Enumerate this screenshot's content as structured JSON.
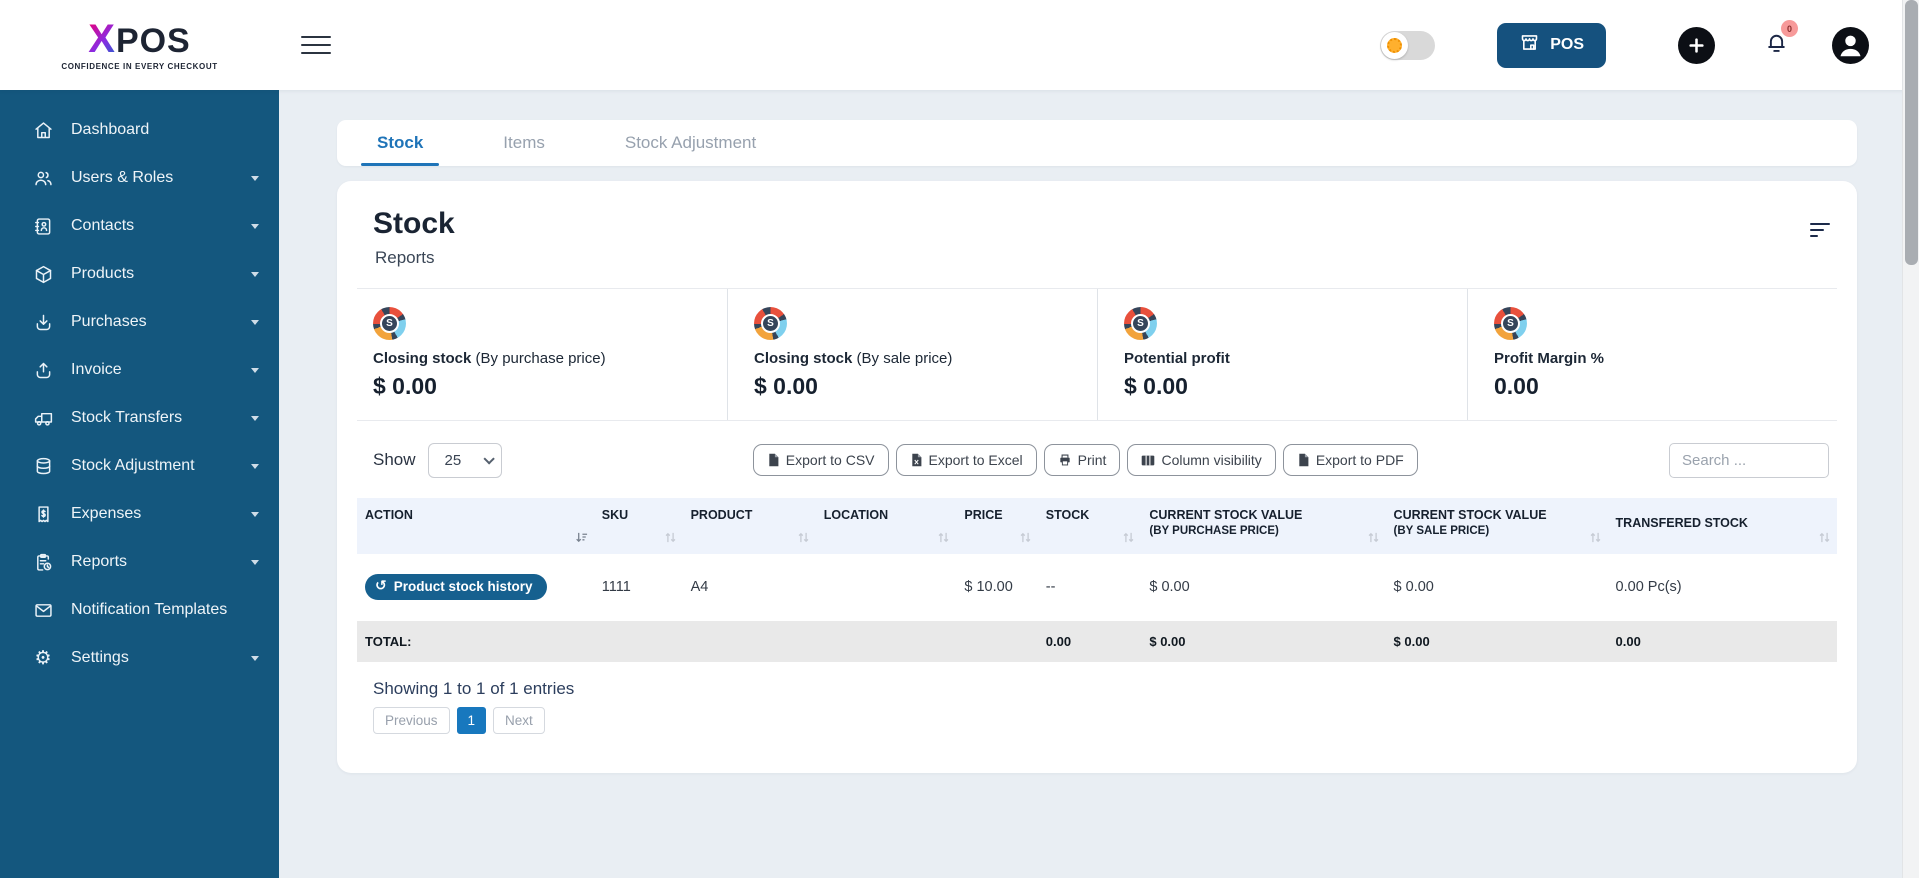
{
  "brand": {
    "name_x": "X",
    "name_rest": "POS",
    "tagline": "CONFIDENCE IN EVERY CHECKOUT"
  },
  "topbar": {
    "pos_label": "POS",
    "bell_badge": "0"
  },
  "sidebar": {
    "items": [
      {
        "label": "Dashboard",
        "icon": "home-icon"
      },
      {
        "label": "Users & Roles",
        "icon": "users-icon"
      },
      {
        "label": "Contacts",
        "icon": "address-book-icon"
      },
      {
        "label": "Products",
        "icon": "box-icon"
      },
      {
        "label": "Purchases",
        "icon": "arrow-down-tray-icon"
      },
      {
        "label": "Invoice",
        "icon": "arrow-up-tray-icon"
      },
      {
        "label": "Stock Transfers",
        "icon": "truck-icon"
      },
      {
        "label": "Stock Adjustment",
        "icon": "database-icon"
      },
      {
        "label": "Expenses",
        "icon": "receipt-icon"
      },
      {
        "label": "Reports",
        "icon": "clipboard-clock-icon"
      },
      {
        "label": "Notification Templates",
        "icon": "envelope-icon"
      },
      {
        "label": "Settings",
        "icon": "gear-icon"
      }
    ]
  },
  "tabs": [
    {
      "label": "Stock",
      "active": true
    },
    {
      "label": "Items",
      "active": false
    },
    {
      "label": "Stock Adjustment",
      "active": false
    }
  ],
  "page": {
    "title": "Stock",
    "subtitle": "Reports"
  },
  "stats": [
    {
      "label": "Closing stock",
      "sublabel": "(By purchase price)",
      "value": "$ 0.00",
      "icon": "stock-donut-icon",
      "icon_letter": "S"
    },
    {
      "label": "Closing stock",
      "sublabel": "(By sale price)",
      "value": "$ 0.00",
      "icon": "stock-donut-icon",
      "icon_letter": "S"
    },
    {
      "label": "Potential profit",
      "sublabel": "",
      "value": "$ 0.00",
      "icon": "stock-donut-icon",
      "icon_letter": "S"
    },
    {
      "label": "Profit Margin %",
      "sublabel": "",
      "value": "0.00",
      "icon": "stock-donut-icon",
      "icon_letter": "S"
    }
  ],
  "controls": {
    "show_label": "Show",
    "page_size": "25",
    "export_csv": "Export to CSV",
    "export_excel": "Export to Excel",
    "print": "Print",
    "column_visibility": "Column visibility",
    "export_pdf": "Export to PDF",
    "search_placeholder": "Search ..."
  },
  "table": {
    "headers": [
      {
        "l1": "ACTION",
        "l2": ""
      },
      {
        "l1": "SKU",
        "l2": ""
      },
      {
        "l1": "PRODUCT",
        "l2": ""
      },
      {
        "l1": "LOCATION",
        "l2": ""
      },
      {
        "l1": "PRICE",
        "l2": ""
      },
      {
        "l1": "STOCK",
        "l2": ""
      },
      {
        "l1": "CURRENT STOCK VALUE",
        "l2": "(BY PURCHASE PRICE)"
      },
      {
        "l1": "CURRENT STOCK VALUE",
        "l2": "(BY SALE PRICE)"
      },
      {
        "l1": "TRANSFERED STOCK",
        "l2": ""
      }
    ],
    "row": {
      "action_button": "Product stock history",
      "sku": "1111",
      "product": "A4",
      "location": "",
      "price": "$ 10.00",
      "stock": "--",
      "value_purchase": "$ 0.00",
      "value_sale": "$ 0.00",
      "transfered": "0.00 Pc(s)"
    },
    "total": {
      "label": "TOTAL:",
      "stock": "0.00",
      "value_purchase": "$ 0.00",
      "value_sale": "$ 0.00",
      "transfered": "0.00"
    }
  },
  "pagination": {
    "summary": "Showing 1 to 1 of 1 entries",
    "previous": "Previous",
    "page": "1",
    "next": "Next"
  },
  "colors": {
    "sidebar": "#14577e",
    "accent_blue": "#1f74b8",
    "pos_button": "#15517e",
    "pill_button": "#16608f",
    "active_page": "#1878be",
    "badge": "#f79a9a",
    "table_header_bg": "#eef3fc",
    "total_row_bg": "#e9e9e9",
    "content_bg": "#e9eef3"
  }
}
